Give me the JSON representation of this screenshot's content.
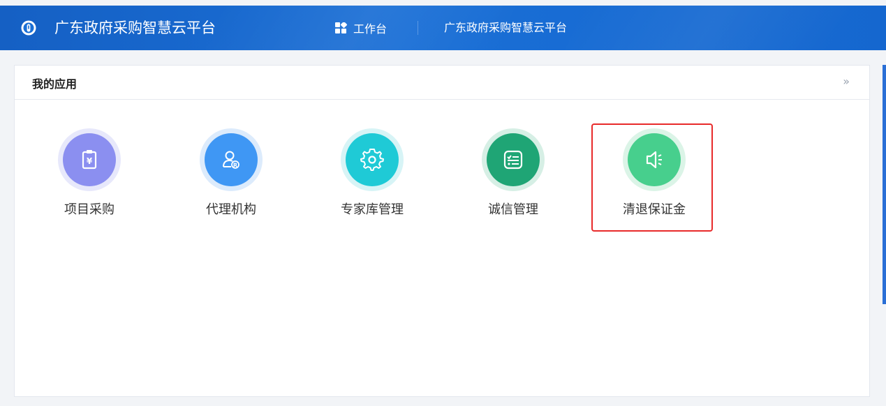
{
  "header": {
    "brand": "广东政府采购智慧云平台",
    "nav_work": "工作台",
    "nav_platform": "广东政府采购智慧云平台"
  },
  "panel": {
    "title": "我的应用",
    "more": "»"
  },
  "apps": [
    {
      "label": "项目采购",
      "icon": "receipt-yen-icon",
      "color": "#8b8ff0",
      "ring": "#e7e8fb"
    },
    {
      "label": "代理机构",
      "icon": "user-registered-icon",
      "color": "#3f97f4",
      "ring": "#dcebfc"
    },
    {
      "label": "专家库管理",
      "icon": "gear-icon",
      "color": "#1fcad6",
      "ring": "#d7f4f6"
    },
    {
      "label": "诚信管理",
      "icon": "checklist-icon",
      "color": "#1fa575",
      "ring": "#d6efe5"
    },
    {
      "label": "清退保证金",
      "icon": "speaker-icon",
      "color": "#47cf8d",
      "ring": "#dbf4e7"
    }
  ],
  "colors": {
    "header_bg": "#1a6fd6",
    "highlight": "#e82a2a"
  }
}
